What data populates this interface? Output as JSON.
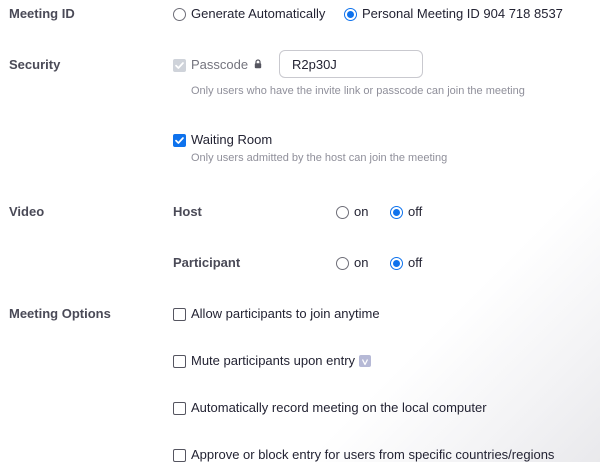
{
  "meeting_id": {
    "label": "Meeting ID",
    "options": [
      {
        "label": "Generate Automatically",
        "checked": false
      },
      {
        "label": "Personal Meeting ID 904 718 8537",
        "checked": true
      }
    ]
  },
  "security": {
    "label": "Security",
    "passcode": {
      "label": "Passcode",
      "checked": true,
      "disabled": true,
      "value": "R2p30J",
      "hint": "Only users who have the invite link or passcode can join the meeting"
    },
    "waiting_room": {
      "label": "Waiting Room",
      "checked": true,
      "hint": "Only users admitted by the host can join the meeting"
    }
  },
  "video": {
    "label": "Video",
    "host": {
      "label": "Host",
      "on_label": "on",
      "off_label": "off",
      "selected": "off"
    },
    "participant": {
      "label": "Participant",
      "on_label": "on",
      "off_label": "off",
      "selected": "off"
    }
  },
  "meeting_options": {
    "label": "Meeting Options",
    "items": [
      {
        "label": "Allow participants to join anytime",
        "checked": false
      },
      {
        "label": "Mute participants upon entry",
        "checked": false
      },
      {
        "label": "Automatically record meeting on the local computer",
        "checked": false
      },
      {
        "label": "Approve or block entry for users from specific countries/regions",
        "checked": false
      }
    ]
  },
  "colors": {
    "accent": "#0e72ed",
    "text": "#232333",
    "hint": "#8f8f9a"
  }
}
